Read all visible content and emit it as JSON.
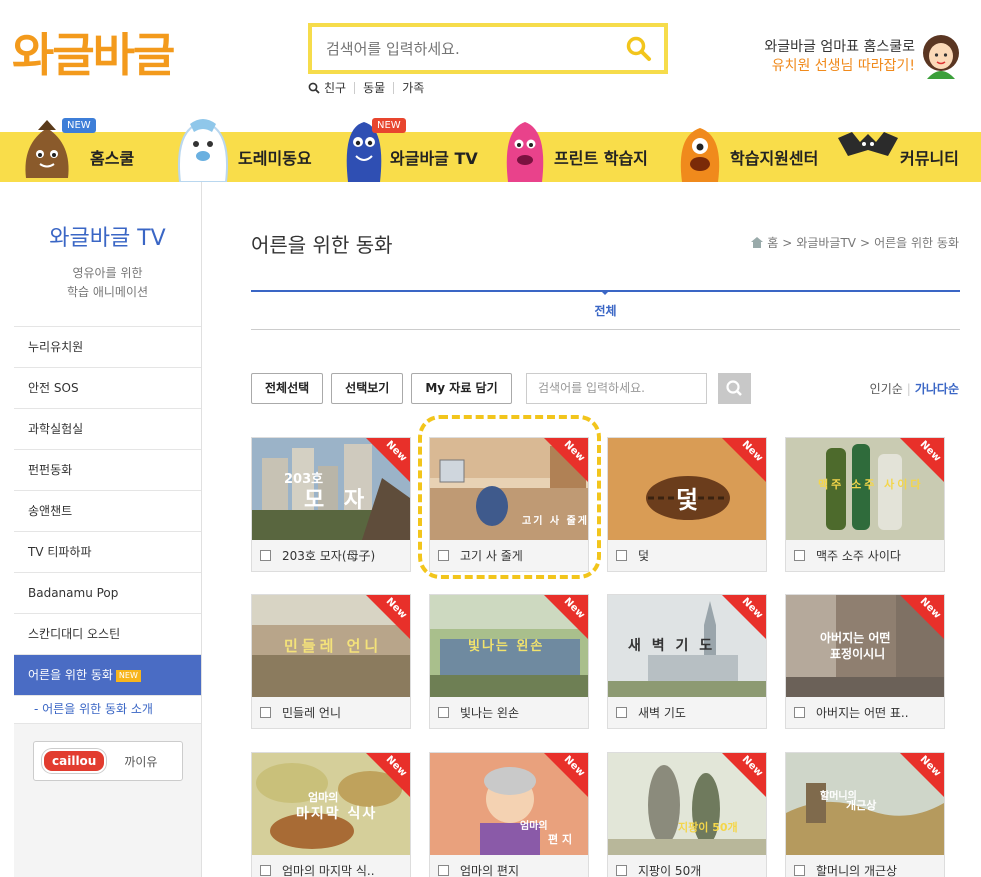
{
  "header": {
    "logo": "와글바글",
    "search_placeholder": "검색어를 입력하세요.",
    "quick_links": [
      "친구",
      "동물",
      "가족"
    ],
    "promo_line1": "와글바글 엄마표 홈스쿨로",
    "promo_line2": "유치원 선생님 따라잡기!"
  },
  "nav": {
    "items": [
      {
        "label": "홈스쿨",
        "badge": "NEW"
      },
      {
        "label": "도레미동요",
        "badge": ""
      },
      {
        "label": "와글바글 TV",
        "badge": "NEW"
      },
      {
        "label": "프린트 학습지",
        "badge": ""
      },
      {
        "label": "학습지원센터",
        "badge": ""
      },
      {
        "label": "커뮤니티",
        "badge": ""
      }
    ]
  },
  "sidebar": {
    "title": "와글바글 TV",
    "subtitle_line1": "영유아를 위한",
    "subtitle_line2": "학습 애니메이션",
    "items": [
      "누리유치원",
      "안전 SOS",
      "과학실험실",
      "펀펀동화",
      "송앤챈트",
      "TV 티파하파",
      "Badanamu Pop",
      "스칸디대디 오스틴",
      "어른을 위한 동화"
    ],
    "active_badge": "NEW",
    "sub_item": "- 어른을 위한 동화 소개",
    "caillou_logo": "caillou",
    "caillou_label": "까이유"
  },
  "main": {
    "page_title": "어른을 위한 동화",
    "breadcrumb": [
      "홈",
      "와글바글TV",
      "어른을 위한 동화"
    ],
    "tab_all": "전체",
    "buttons": {
      "select_all": "전체선택",
      "view_selected": "선택보기",
      "my_save": "My 자료 담기"
    },
    "search_placeholder": "검색어를 입력하세요.",
    "sort_popular": "인기순",
    "sort_abc": "가나다순"
  },
  "videos": [
    {
      "title": "203호 모자(母子)",
      "thumb_text": "203호 모자",
      "new": "New"
    },
    {
      "title": "고기 사 줄게",
      "thumb_text": "고기 사 줄게",
      "new": "New"
    },
    {
      "title": "덫",
      "thumb_text": "덫",
      "new": "New"
    },
    {
      "title": "맥주 소주 사이다",
      "thumb_text": "맥주 소주 사이다",
      "new": "New"
    },
    {
      "title": "민들레 언니",
      "thumb_text": "민들레 언니",
      "new": "New"
    },
    {
      "title": "빛나는 왼손",
      "thumb_text": "빛나는 왼손",
      "new": "New"
    },
    {
      "title": "새벽 기도",
      "thumb_text": "새 벽 기 도",
      "new": "New"
    },
    {
      "title": "아버지는 어떤 표..",
      "thumb_text_line1": "아버지는 어떤",
      "thumb_text_line2": "표정이시니",
      "new": "New"
    },
    {
      "title": "엄마의 마지막 식..",
      "thumb_text_line1": "엄마의",
      "thumb_text_line2": "마지막 식사",
      "new": "New"
    },
    {
      "title": "엄마의 편지",
      "thumb_text_line1": "엄마의",
      "thumb_text_line2": "편 지",
      "new": "New"
    },
    {
      "title": "지팡이 50개",
      "thumb_text": "지팡이 50개",
      "new": "New"
    },
    {
      "title": "할머니의 개근상",
      "thumb_text_line1": "할머니의",
      "thumb_text_line2": "개근상",
      "new": "New"
    }
  ]
}
